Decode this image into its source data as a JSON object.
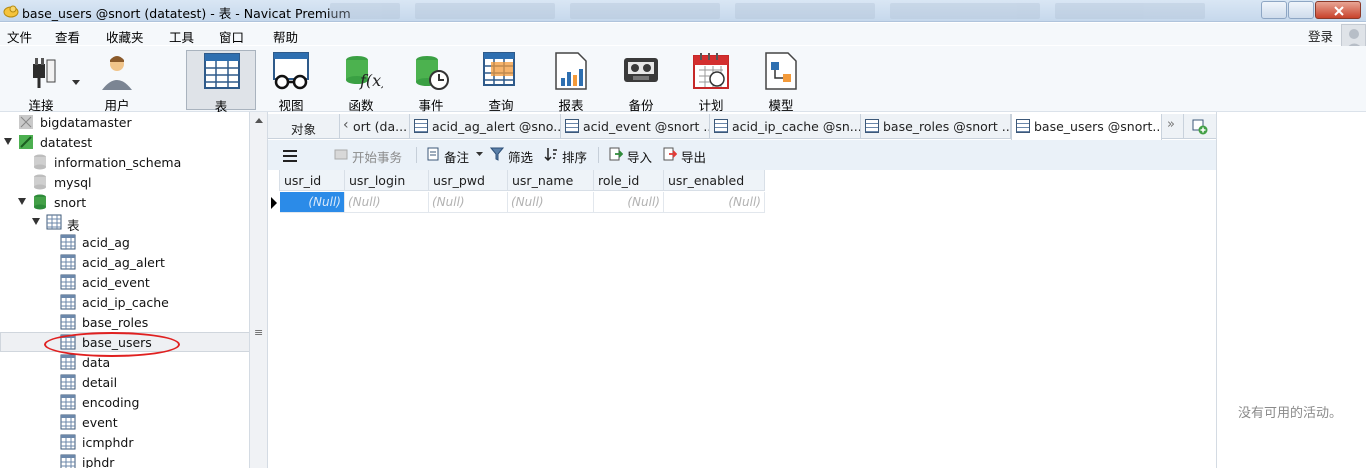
{
  "window": {
    "title": "base_users @snort (datatest) - 表 - Navicat Premium"
  },
  "menu": {
    "items": [
      "文件",
      "查看",
      "收藏夹",
      "工具",
      "窗口",
      "帮助"
    ],
    "login": "登录"
  },
  "toolbar": {
    "items": [
      {
        "label": "连接",
        "icon": "plug-icon"
      },
      {
        "label": "用户",
        "icon": "user-icon"
      },
      {
        "label": "表",
        "icon": "table-icon",
        "active": true
      },
      {
        "label": "视图",
        "icon": "view-icon"
      },
      {
        "label": "函数",
        "icon": "function-icon"
      },
      {
        "label": "事件",
        "icon": "event-icon"
      },
      {
        "label": "查询",
        "icon": "query-icon"
      },
      {
        "label": "报表",
        "icon": "report-icon"
      },
      {
        "label": "备份",
        "icon": "backup-icon"
      },
      {
        "label": "计划",
        "icon": "calendar-icon"
      },
      {
        "label": "模型",
        "icon": "model-icon"
      }
    ]
  },
  "tree": {
    "items": [
      {
        "label": "bigdatamaster",
        "level": 0,
        "icon": "connection-icon"
      },
      {
        "label": "datatest",
        "level": 0,
        "icon": "connection-icon",
        "expanded": true
      },
      {
        "label": "information_schema",
        "level": 1,
        "icon": "database-icon"
      },
      {
        "label": "mysql",
        "level": 1,
        "icon": "database-icon"
      },
      {
        "label": "snort",
        "level": 1,
        "icon": "database-icon",
        "expanded": true
      },
      {
        "label": "表",
        "level": 2,
        "icon": "tables-folder-icon",
        "expanded": true
      },
      {
        "label": "acid_ag",
        "level": 3,
        "icon": "table-icon"
      },
      {
        "label": "acid_ag_alert",
        "level": 3,
        "icon": "table-icon"
      },
      {
        "label": "acid_event",
        "level": 3,
        "icon": "table-icon"
      },
      {
        "label": "acid_ip_cache",
        "level": 3,
        "icon": "table-icon"
      },
      {
        "label": "base_roles",
        "level": 3,
        "icon": "table-icon"
      },
      {
        "label": "base_users",
        "level": 3,
        "icon": "table-icon",
        "selected": true
      },
      {
        "label": "data",
        "level": 3,
        "icon": "table-icon"
      },
      {
        "label": "detail",
        "level": 3,
        "icon": "table-icon"
      },
      {
        "label": "encoding",
        "level": 3,
        "icon": "table-icon"
      },
      {
        "label": "event",
        "level": 3,
        "icon": "table-icon"
      },
      {
        "label": "icmphdr",
        "level": 3,
        "icon": "table-icon"
      },
      {
        "label": "iphdr",
        "level": 3,
        "icon": "table-icon"
      }
    ]
  },
  "tabs": {
    "objects": "对象",
    "items": [
      "ort (da...",
      "acid_ag_alert @sno...",
      "acid_event @snort ...",
      "acid_ip_cache @sn...",
      "base_roles @snort ...",
      "base_users @snort..."
    ],
    "active_index": 5
  },
  "subtoolbar": {
    "menu": "menu-icon",
    "begin_transaction": "开始事务",
    "note": "备注",
    "filter": "筛选",
    "sort": "排序",
    "import": "导入",
    "export": "导出"
  },
  "grid": {
    "columns": [
      "usr_id",
      "usr_login",
      "usr_pwd",
      "usr_name",
      "role_id",
      "usr_enabled"
    ],
    "rows": [
      [
        "(Null)",
        "(Null)",
        "(Null)",
        "(Null)",
        "(Null)",
        "(Null)"
      ]
    ]
  },
  "status": {
    "activation": "没有可用的活动。"
  },
  "colors": {
    "accent": "#2b8be8",
    "selection_outline": "#e02020"
  }
}
